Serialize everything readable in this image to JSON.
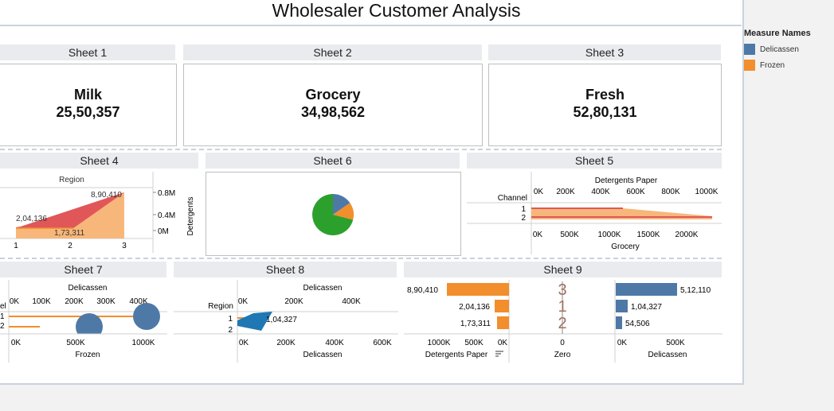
{
  "title": "Wholesaler  Customer  Analysis",
  "colors": {
    "delicassen": "#4e79a7",
    "frozen": "#f28e2b",
    "green": "#2ca02c",
    "red": "#e15759",
    "peach": "#f7b77a"
  },
  "legend": {
    "title": "Measure Names",
    "items": [
      {
        "label": "Delicassen",
        "color": "#4e79a7"
      },
      {
        "label": "Frozen",
        "color": "#f28e2b"
      }
    ]
  },
  "sheets": {
    "s1": {
      "header": "Sheet 1",
      "name": "Milk",
      "value": "25,50,357"
    },
    "s2": {
      "header": "Sheet 2",
      "name": "Grocery",
      "value": "34,98,562"
    },
    "s3": {
      "header": "Sheet 3",
      "name": "Fresh",
      "value": "52,80,131"
    },
    "s4": {
      "header": "Sheet 4",
      "top_label": "Region",
      "y_label": "Detergents",
      "y_ticks": [
        "0.8M",
        "0.4M",
        "0M"
      ],
      "x_ticks": [
        "1",
        "2",
        "3"
      ],
      "labels": [
        "8,90,410",
        "2,04,136",
        "1,73,311"
      ]
    },
    "s5": {
      "header": "Sheet 5",
      "top_axis_title": "Detergents Paper",
      "top_ticks": [
        "0K",
        "200K",
        "400K",
        "600K",
        "800K",
        "1000K"
      ],
      "row_title": "Channel",
      "rows": [
        "1",
        "2"
      ],
      "bottom_ticks": [
        "0K",
        "500K",
        "1000K",
        "1500K",
        "2000K"
      ],
      "bottom_axis_title": "Grocery"
    },
    "s6": {
      "header": "Sheet 6"
    },
    "s7": {
      "header": "Sheet 7",
      "top_axis_title": "Delicassen",
      "top_ticks": [
        "0K",
        "100K",
        "200K",
        "300K",
        "400K"
      ],
      "row_title": "el",
      "rows": [
        "1",
        "2"
      ],
      "bottom_ticks": [
        "0K",
        "500K",
        "1000K"
      ],
      "bottom_axis_title": "Frozen"
    },
    "s8": {
      "header": "Sheet 8",
      "top_axis_title": "Delicassen",
      "top_ticks": [
        "0K",
        "200K",
        "400K"
      ],
      "row_title": "Region",
      "rows": [
        "1",
        "2"
      ],
      "bar_label": "1,04,327",
      "bottom_ticks": [
        "0K",
        "200K",
        "400K",
        "600K"
      ],
      "bottom_axis_title": "Delicassen"
    },
    "s9": {
      "header": "Sheet 9",
      "left_labels": [
        "8,90,410",
        "2,04,136",
        "1,73,311"
      ],
      "mid_labels": [
        "3",
        "1",
        "2"
      ],
      "right_labels": [
        "5,12,110",
        "1,04,327",
        "54,506"
      ],
      "left_ticks": [
        "1000K",
        "500K",
        "0K"
      ],
      "left_axis_title": "Detergents Paper",
      "sort_icon": "sort-icon",
      "mid_tick": "0",
      "mid_axis_title": "Zero",
      "right_ticks": [
        "0K",
        "500K"
      ],
      "right_axis_title": "Delicassen"
    }
  }
}
